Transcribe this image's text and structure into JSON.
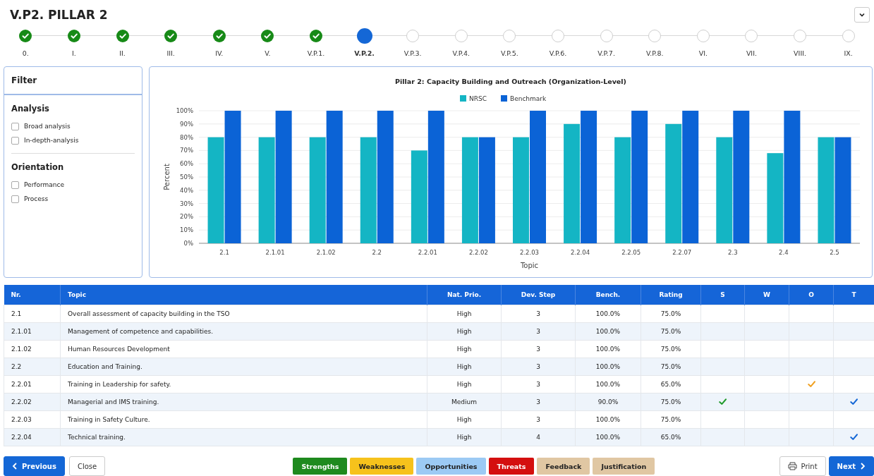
{
  "title": "V.P2. PILLAR 2",
  "steps": [
    {
      "label": "0.",
      "completed": true,
      "selected": false
    },
    {
      "label": "I.",
      "completed": true,
      "selected": false
    },
    {
      "label": "II.",
      "completed": true,
      "selected": false
    },
    {
      "label": "III.",
      "completed": true,
      "selected": false
    },
    {
      "label": "IV.",
      "completed": true,
      "selected": false
    },
    {
      "label": "V.",
      "completed": true,
      "selected": false
    },
    {
      "label": "V.P.1.",
      "completed": true,
      "selected": false
    },
    {
      "label": "V.P.2.",
      "completed": false,
      "selected": true
    },
    {
      "label": "V.P.3.",
      "completed": false,
      "selected": false
    },
    {
      "label": "V.P.4.",
      "completed": false,
      "selected": false
    },
    {
      "label": "V.P.5.",
      "completed": false,
      "selected": false
    },
    {
      "label": "V.P.6.",
      "completed": false,
      "selected": false
    },
    {
      "label": "V.P.7.",
      "completed": false,
      "selected": false
    },
    {
      "label": "V.P.8.",
      "completed": false,
      "selected": false
    },
    {
      "label": "VI.",
      "completed": false,
      "selected": false
    },
    {
      "label": "VII.",
      "completed": false,
      "selected": false
    },
    {
      "label": "VIII.",
      "completed": false,
      "selected": false
    },
    {
      "label": "IX.",
      "completed": false,
      "selected": false
    }
  ],
  "filter": {
    "title": "Filter",
    "groups": [
      {
        "title": "Analysis",
        "options": [
          {
            "label": "Broad analysis",
            "checked": false
          },
          {
            "label": "In-depth-analysis",
            "checked": false
          }
        ]
      },
      {
        "title": "Orientation",
        "options": [
          {
            "label": "Performance",
            "checked": false
          },
          {
            "label": "Process",
            "checked": false
          }
        ]
      }
    ]
  },
  "chart_data": {
    "type": "bar",
    "title": "Pillar 2: Capacity Building and Outreach (Organization-Level)",
    "xlabel": "Topic",
    "ylabel": "Percent",
    "categories": [
      "2.1",
      "2.1.01",
      "2.1.02",
      "2.2",
      "2.2.01",
      "2.2.02",
      "2.2.03",
      "2.2.04",
      "2.2.05",
      "2.2.07",
      "2.3",
      "2.4",
      "2.5"
    ],
    "series": [
      {
        "name": "NRSC",
        "color": "#14b5c4",
        "values": [
          80,
          80,
          80,
          80,
          70,
          80,
          80,
          90,
          80,
          90,
          80,
          68,
          80
        ]
      },
      {
        "name": "Benchmark",
        "color": "#0b63d6",
        "values": [
          100,
          100,
          100,
          100,
          100,
          80,
          100,
          100,
          100,
          100,
          100,
          100,
          80
        ]
      }
    ],
    "ylim": [
      0,
      100
    ],
    "grid": true,
    "legend": true,
    "yticks": [
      {
        "value": 0,
        "label": "0%"
      },
      {
        "value": 10,
        "label": "10%"
      },
      {
        "value": 20,
        "label": "20%"
      },
      {
        "value": 30,
        "label": "30%"
      },
      {
        "value": 40,
        "label": "40%"
      },
      {
        "value": 50,
        "label": "50%"
      },
      {
        "value": 60,
        "label": "60%"
      },
      {
        "value": 70,
        "label": "70%"
      },
      {
        "value": 80,
        "label": "80%"
      },
      {
        "value": 90,
        "label": "90%"
      },
      {
        "value": 100,
        "label": "100%"
      }
    ]
  },
  "table": {
    "columns": [
      "Nr.",
      "Topic",
      "Nat. Prio.",
      "Dev. Step",
      "Bench.",
      "Rating",
      "S",
      "W",
      "O",
      "T"
    ],
    "rows": [
      {
        "nr": "2.1",
        "topic": "Overall assessment of capacity building in the TSO",
        "prio": "High",
        "step": "3",
        "bench": "100.0%",
        "rating": "75.0%",
        "s": false,
        "w": false,
        "o": false,
        "t": false
      },
      {
        "nr": "2.1.01",
        "topic": "Management of competence and capabilities.",
        "prio": "High",
        "step": "3",
        "bench": "100.0%",
        "rating": "75.0%",
        "s": false,
        "w": false,
        "o": false,
        "t": false
      },
      {
        "nr": "2.1.02",
        "topic": "Human Resources Development",
        "prio": "High",
        "step": "3",
        "bench": "100.0%",
        "rating": "75.0%",
        "s": false,
        "w": false,
        "o": false,
        "t": false
      },
      {
        "nr": "2.2",
        "topic": "Education and Training.",
        "prio": "High",
        "step": "3",
        "bench": "100.0%",
        "rating": "75.0%",
        "s": false,
        "w": false,
        "o": false,
        "t": false
      },
      {
        "nr": "2.2.01",
        "topic": "Training in Leadership for safety.",
        "prio": "High",
        "step": "3",
        "bench": "100.0%",
        "rating": "65.0%",
        "s": false,
        "w": false,
        "o": true,
        "t": false
      },
      {
        "nr": "2.2.02",
        "topic": "Managerial and IMS training.",
        "prio": "Medium",
        "step": "3",
        "bench": "90.0%",
        "rating": "75.0%",
        "s": true,
        "w": false,
        "o": false,
        "t": true
      },
      {
        "nr": "2.2.03",
        "topic": "Training in Safety Culture.",
        "prio": "High",
        "step": "3",
        "bench": "100.0%",
        "rating": "75.0%",
        "s": false,
        "w": false,
        "o": false,
        "t": false
      },
      {
        "nr": "2.2.04",
        "topic": "Technical training.",
        "prio": "High",
        "step": "4",
        "bench": "100.0%",
        "rating": "65.0%",
        "s": false,
        "w": false,
        "o": false,
        "t": true
      }
    ]
  },
  "nav": {
    "previous": "Previous",
    "close": "Close",
    "print": "Print",
    "next": "Next"
  },
  "swot_buttons": [
    {
      "label": "Strengths",
      "color": "#1e8a1e"
    },
    {
      "label": "Weaknesses",
      "color": "#f6c21c"
    },
    {
      "label": "Opportunities",
      "color": "#9ccaf4"
    },
    {
      "label": "Threats",
      "color": "#d40f0f"
    },
    {
      "label": "Feedback",
      "color": "#e0c7a3"
    },
    {
      "label": "Justification",
      "color": "#e0c7a3"
    }
  ]
}
